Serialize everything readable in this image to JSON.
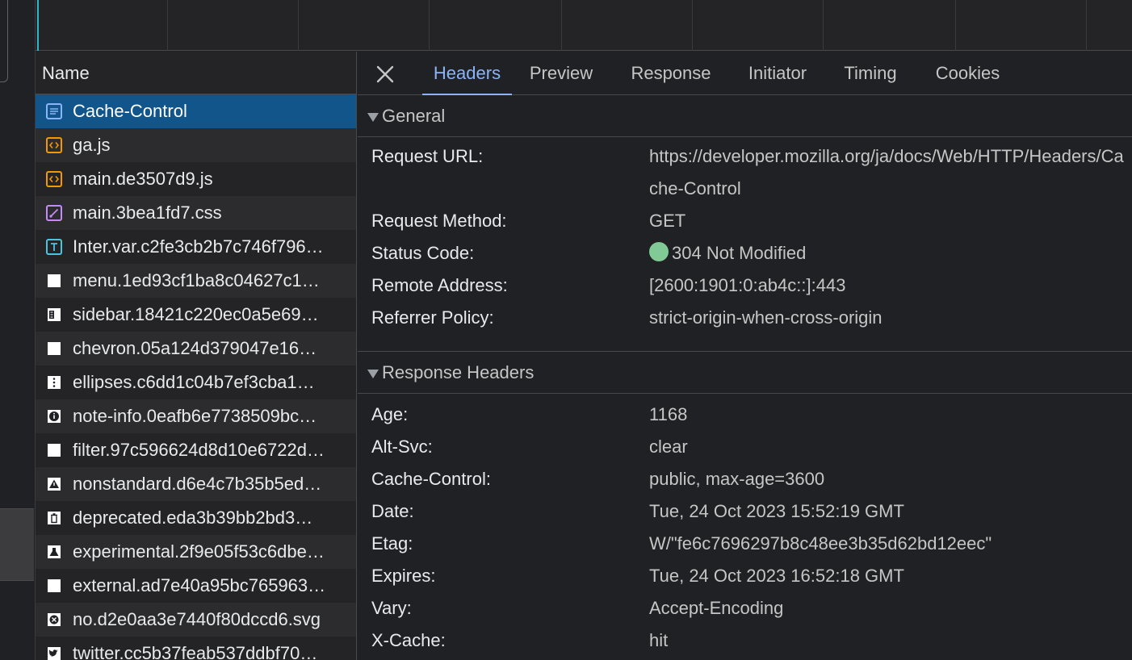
{
  "overview": {
    "marker_color": "#2fb7c8"
  },
  "name_column": {
    "header": "Name",
    "files": [
      {
        "name": "Cache-Control",
        "icon": "document-icon",
        "selected": true
      },
      {
        "name": "ga.js",
        "icon": "script-icon"
      },
      {
        "name": "main.de3507d9.js",
        "icon": "script-icon"
      },
      {
        "name": "main.3bea1fd7.css",
        "icon": "stylesheet-icon"
      },
      {
        "name": "Inter.var.c2fe3cb2b7c746f796…",
        "icon": "font-icon"
      },
      {
        "name": "menu.1ed93cf1ba8c04627c1…",
        "icon": "image-icon"
      },
      {
        "name": "sidebar.18421c220ec0a5e69…",
        "icon": "sidebar-image-icon"
      },
      {
        "name": "chevron.05a124d379047e16…",
        "icon": "image-icon"
      },
      {
        "name": "ellipses.c6dd1c04b7ef3cba1…",
        "icon": "ellipses-image-icon"
      },
      {
        "name": "note-info.0eafb6e7738509bc…",
        "icon": "info-image-icon"
      },
      {
        "name": "filter.97c596624d8d10e6722d…",
        "icon": "image-icon"
      },
      {
        "name": "nonstandard.d6e4c7b35b5ed…",
        "icon": "warning-image-icon"
      },
      {
        "name": "deprecated.eda3b39bb2bd3…",
        "icon": "trash-image-icon"
      },
      {
        "name": "experimental.2f9e05f53c6dbe…",
        "icon": "flask-image-icon"
      },
      {
        "name": "external.ad7e40a95bc765963…",
        "icon": "image-icon"
      },
      {
        "name": "no.d2e0aa3e7440f80dccd6.svg",
        "icon": "no-image-icon"
      },
      {
        "name": "twitter.cc5b37feab537ddbf70…",
        "icon": "twitter-image-icon"
      }
    ]
  },
  "tabs": {
    "close_icon": "close-icon",
    "headers": "Headers",
    "preview": "Preview",
    "response": "Response",
    "initiator": "Initiator",
    "timing": "Timing",
    "cookies": "Cookies",
    "active": "Headers"
  },
  "general": {
    "title": "General",
    "request_url_label": "Request URL:",
    "request_url": "https://developer.mozilla.org/ja/docs/Web/HTTP/Headers/Cache-Control",
    "request_method_label": "Request Method:",
    "request_method": "GET",
    "status_code_label": "Status Code:",
    "status_code": "304 Not Modified",
    "status_color": "#81c995",
    "remote_address_label": "Remote Address:",
    "remote_address": "[2600:1901:0:ab4c::]:443",
    "referrer_policy_label": "Referrer Policy:",
    "referrer_policy": "strict-origin-when-cross-origin"
  },
  "response_headers": {
    "title": "Response Headers",
    "age_label": "Age:",
    "age": "1168",
    "alt_svc_label": "Alt-Svc:",
    "alt_svc": "clear",
    "cache_control_label": "Cache-Control:",
    "cache_control": "public, max-age=3600",
    "date_label": "Date:",
    "date": "Tue, 24 Oct 2023 15:52:19 GMT",
    "etag_label": "Etag:",
    "etag": "W/\"fe6c7696297b8c48ee3b35d62bd12eec\"",
    "expires_label": "Expires:",
    "expires": "Tue, 24 Oct 2023 16:52:18 GMT",
    "vary_label": "Vary:",
    "vary": "Accept-Encoding",
    "x_cache_label": "X-Cache:",
    "x_cache": "hit"
  }
}
